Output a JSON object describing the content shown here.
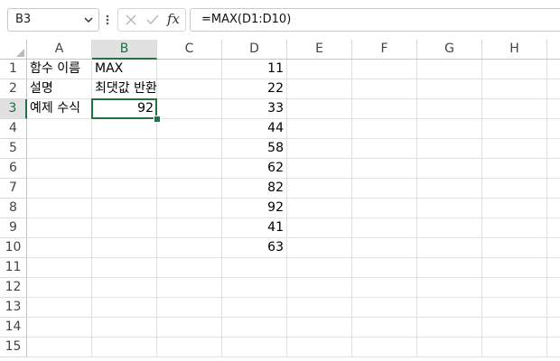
{
  "name_box": {
    "value": "B3"
  },
  "formula_bar": {
    "fx_label": "fx",
    "formula": "=MAX(D1:D10)"
  },
  "grid": {
    "selected_cell": "B3",
    "columns": [
      "A",
      "B",
      "C",
      "D",
      "E",
      "F",
      "G",
      "H"
    ],
    "rows": [
      "1",
      "2",
      "3",
      "4",
      "5",
      "6",
      "7",
      "8",
      "9",
      "10",
      "11",
      "12",
      "13",
      "14",
      "15"
    ],
    "cells": {
      "A1": "함수 이름",
      "B1": "MAX",
      "A2": "설명",
      "B2": "최댓값 반환",
      "A3": "예제 수식",
      "B3": "92",
      "D1": "11",
      "D2": "22",
      "D3": "33",
      "D4": "44",
      "D5": "58",
      "D6": "62",
      "D7": "82",
      "D8": "92",
      "D9": "41",
      "D10": "63"
    }
  },
  "colors": {
    "accent": "#217346",
    "header_selected_bg": "#e1e1e1"
  }
}
